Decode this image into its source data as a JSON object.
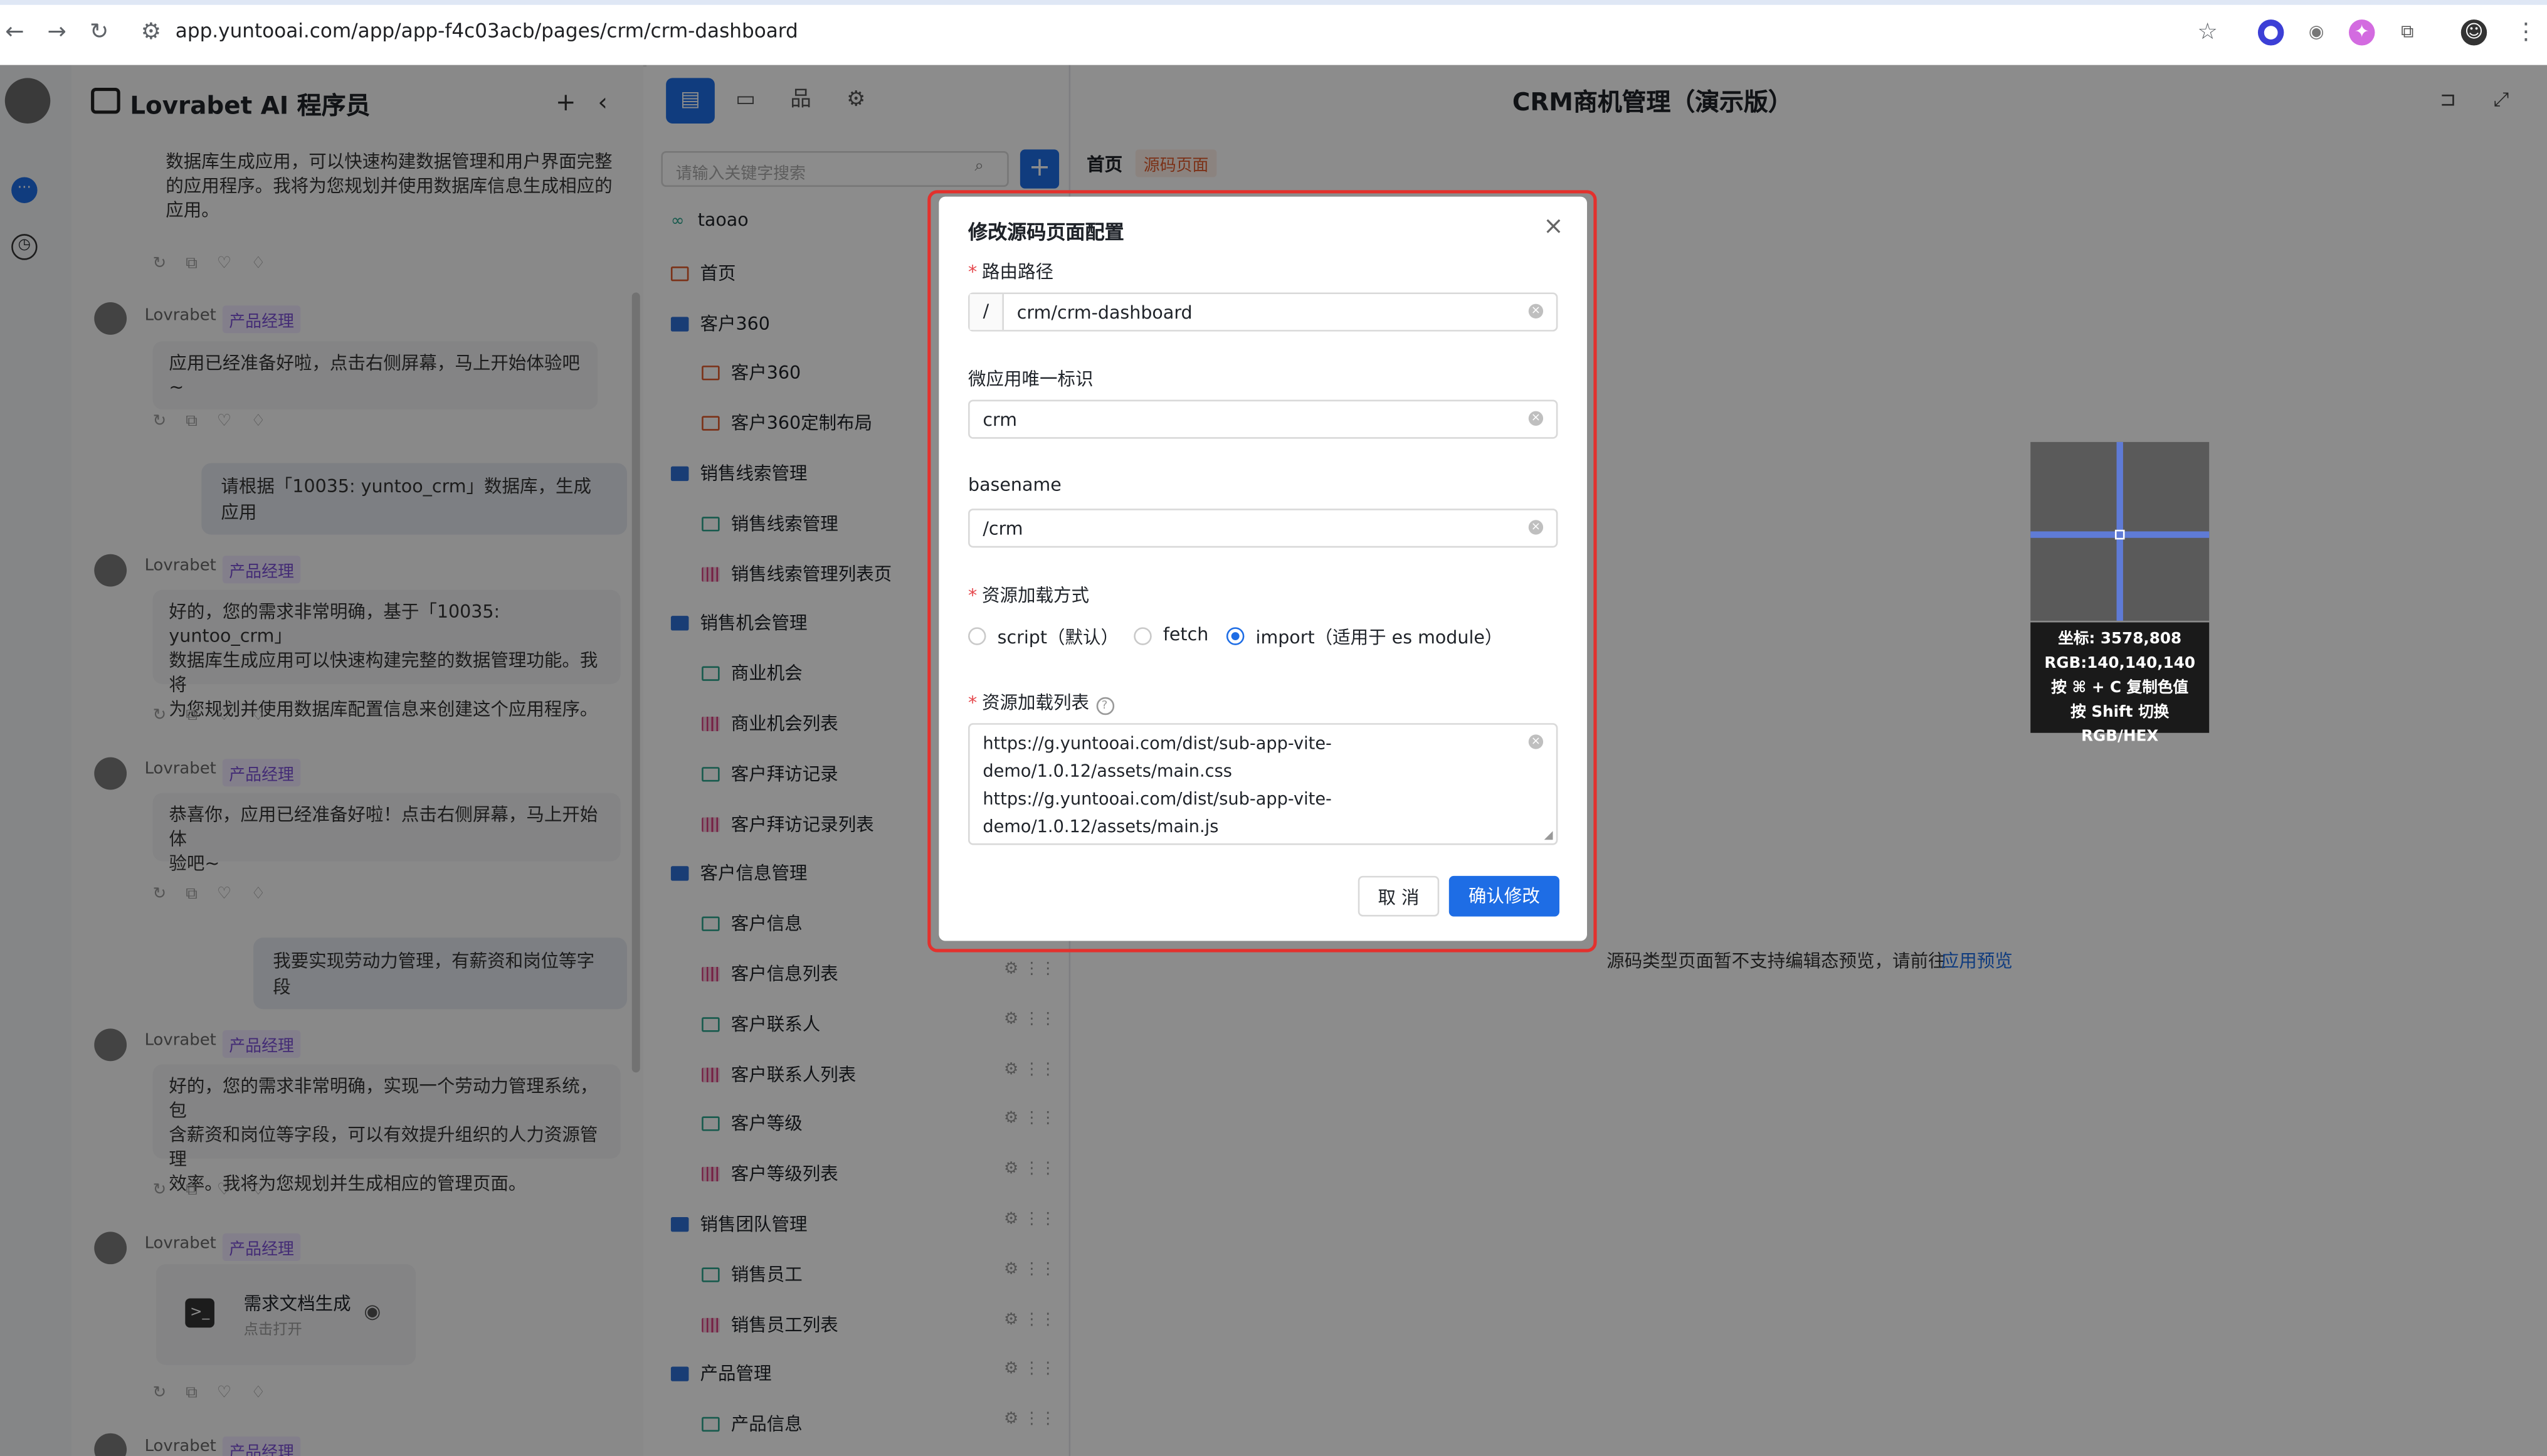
{
  "browser": {
    "url": "app.yuntooai.com/app/app-f4c03acb/pages/crm/crm-dashboard"
  },
  "chat": {
    "title": "Lovrabet AI 程序员",
    "top_text": [
      "数据库生成应用，可以快速构建数据管理和用户界面完整",
      "的应用程序。我将为您规划并使用数据库信息生成相应的",
      "应用。"
    ],
    "sender": "Lovrabet",
    "role_tag": "产品经理",
    "msg1": "应用已经准备好啦，点击右侧屏幕，马上开始体验吧~",
    "user1": "请根据「10035: yuntoo_crm」数据库，生成应用",
    "msg2": [
      "好的，您的需求非常明确，基于「10035: yuntoo_crm」",
      "数据库生成应用可以快速构建完整的数据管理功能。我将",
      "为您规划并使用数据库配置信息来创建这个应用程序。"
    ],
    "msg3": [
      "恭喜你，应用已经准备好啦！点击右侧屏幕，马上开始体",
      "验吧~"
    ],
    "user2": "我要实现劳动力管理，有薪资和岗位等字段",
    "msg4": [
      "好的，您的需求非常明确，实现一个劳动力管理系统，包",
      "含薪资和岗位等字段，可以有效提升组织的人力资源管理",
      "效率。我将为您规划并生成相应的管理页面。"
    ],
    "doc_card": {
      "title": "需求文档生成",
      "sub": "点击打开"
    }
  },
  "sidebar": {
    "search_placeholder": "请输入关键字搜索",
    "items": [
      {
        "label": "taoao",
        "type": "link",
        "indent": 0
      },
      {
        "label": "首页",
        "type": "src",
        "indent": 0
      },
      {
        "label": "客户360",
        "type": "folder",
        "indent": 0
      },
      {
        "label": "客户360",
        "type": "src",
        "indent": 1
      },
      {
        "label": "客户360定制布局",
        "type": "src",
        "indent": 1
      },
      {
        "label": "销售线索管理",
        "type": "folder",
        "indent": 0
      },
      {
        "label": "销售线索管理",
        "type": "form",
        "indent": 1
      },
      {
        "label": "销售线索管理列表页",
        "type": "table",
        "indent": 1
      },
      {
        "label": "销售机会管理",
        "type": "folder",
        "indent": 0
      },
      {
        "label": "商业机会",
        "type": "form",
        "indent": 1
      },
      {
        "label": "商业机会列表",
        "type": "table",
        "indent": 1
      },
      {
        "label": "客户拜访记录",
        "type": "form",
        "indent": 1
      },
      {
        "label": "客户拜访记录列表",
        "type": "table",
        "indent": 1
      },
      {
        "label": "客户信息管理",
        "type": "folder",
        "indent": 0
      },
      {
        "label": "客户信息",
        "type": "form",
        "indent": 1
      },
      {
        "label": "客户信息列表",
        "type": "table",
        "indent": 1
      },
      {
        "label": "客户联系人",
        "type": "form",
        "indent": 1
      },
      {
        "label": "客户联系人列表",
        "type": "table",
        "indent": 1
      },
      {
        "label": "客户等级",
        "type": "form",
        "indent": 1
      },
      {
        "label": "客户等级列表",
        "type": "table",
        "indent": 1
      },
      {
        "label": "销售团队管理",
        "type": "folder",
        "indent": 0
      },
      {
        "label": "销售员工",
        "type": "form",
        "indent": 1
      },
      {
        "label": "销售员工列表",
        "type": "table",
        "indent": 1
      },
      {
        "label": "产品管理",
        "type": "folder",
        "indent": 0
      },
      {
        "label": "产品信息",
        "type": "form",
        "indent": 1
      }
    ]
  },
  "main": {
    "title": "CRM商机管理（演示版）",
    "breadcrumb_home": "首页",
    "breadcrumb_tab": "源码页面",
    "preview_note": "源码类型页面暂不支持编辑态预览，请前往",
    "preview_link": "应用预览"
  },
  "modal": {
    "title": "修改源码页面配置",
    "route_label": "路由路径",
    "route_prefix": "/",
    "route_value": "crm/crm-dashboard",
    "app_id_label": "微应用唯一标识",
    "app_id_value": "crm",
    "basename_label": "basename",
    "basename_value": "/crm",
    "load_mode_label": "资源加载方式",
    "load_options": [
      "script（默认）",
      "fetch",
      "import（适用于 es module）"
    ],
    "load_selected": "import（适用于 es module）",
    "resource_list_label": "资源加载列表",
    "resource_lines": [
      "https://g.yuntooai.com/dist/sub-app-vite-",
      "demo/1.0.12/assets/main.css",
      "https://g.yuntooai.com/dist/sub-app-vite-",
      "demo/1.0.12/assets/main.js"
    ],
    "cancel": "取 消",
    "confirm": "确认修改"
  },
  "picker": {
    "coord": "坐标: 3578,808",
    "rgb": "RGB:140,140,140",
    "copy_hint": "按 ⌘ + C 复制色值",
    "shift_hint": "按 Shift 切换 RGB/HEX"
  },
  "colors": {
    "accent": "#1e6de5",
    "highlight": "#e3312d",
    "tag": "#7b4fd6"
  }
}
